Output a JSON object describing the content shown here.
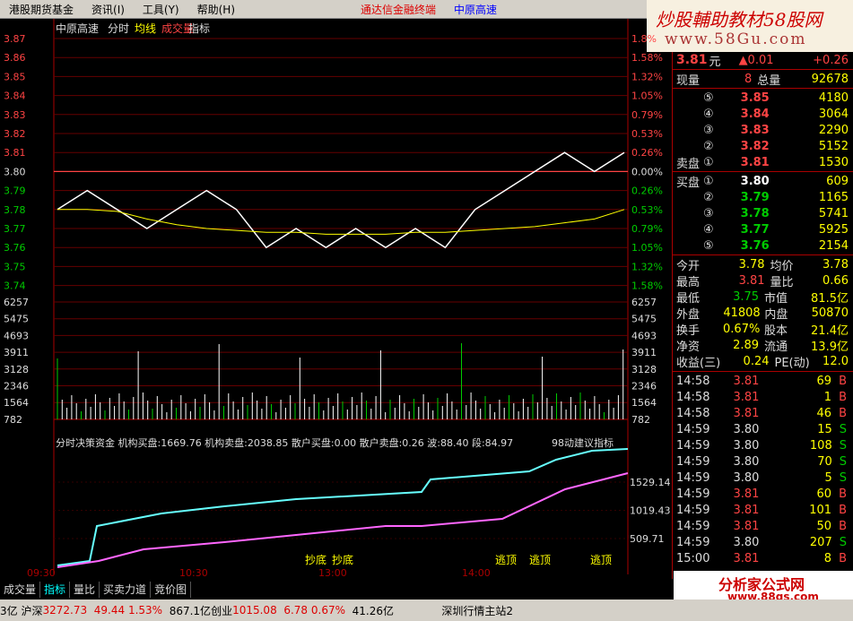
{
  "menu": {
    "items": [
      "港股期货基金",
      "资讯(I)",
      "工具(Y)",
      "帮助(H)"
    ],
    "brand": "通达信金融终端",
    "stock_name": "中原高速"
  },
  "logo": {
    "line1": "炒股輔助教材58股网",
    "line2": "www.58Gu.com"
  },
  "chart": {
    "header": {
      "name": "中原高速",
      "tabs": [
        "分时",
        "均线",
        "成交量",
        "指标"
      ]
    },
    "price_left": [
      "3.87",
      "3.86",
      "3.85",
      "3.84",
      "3.83",
      "3.82",
      "3.81",
      "3.80",
      "3.79",
      "3.78",
      "3.77",
      "3.76",
      "3.75",
      "3.74"
    ],
    "price_right": [
      "1.8%",
      "1.58%",
      "1.32%",
      "1.05%",
      "0.79%",
      "0.53%",
      "0.26%",
      "0.00%",
      "0.26%",
      "0.53%",
      "0.79%",
      "1.05%",
      "1.32%",
      "1.58%"
    ],
    "vol_left": [
      "6257",
      "5475",
      "4693",
      "3911",
      "3128",
      "2346",
      "1564",
      "782"
    ],
    "vol_right": [
      "6257",
      "5475",
      "4693",
      "3911",
      "3128",
      "2346",
      "1564",
      "782"
    ],
    "indicator_title": "分时决策资金 机构买盘:1669.76 机构卖盘:2038.85 散户买盘:0.00 散户卖盘:0.26 波:88.40 段:84.97",
    "indicator_tag": "98动建议指标",
    "ind_right": [
      "1529.14",
      "1019.43",
      "509.71"
    ],
    "time_labels": [
      "09:30",
      "10:30",
      "13:00",
      "14:00"
    ],
    "signals": [
      "抄底",
      "抄底",
      "逃顶",
      "逃顶",
      "逃顶"
    ]
  },
  "chart_data": {
    "type": "line",
    "series": [
      {
        "values": [
          3.78,
          3.79,
          3.78,
          3.77,
          3.78,
          3.79,
          3.78,
          3.76,
          3.77,
          3.76,
          3.77,
          3.76,
          3.77,
          3.76,
          3.78,
          3.79,
          3.8,
          3.81,
          3.8,
          3.81
        ]
      },
      {
        "values": [
          3.78,
          3.78,
          3.779,
          3.775,
          3.772,
          3.77,
          3.769,
          3.768,
          3.768,
          3.767,
          3.767,
          3.767,
          3.768,
          3.768,
          3.769,
          3.77,
          3.771,
          3.773,
          3.775,
          3.78
        ]
      }
    ],
    "ylim": [
      3.74,
      3.87
    ]
  },
  "panel": {
    "price": "3.81",
    "unit": "元",
    "change": "▲0.01",
    "change2": "+0.26",
    "now_vol_label": "现量",
    "now_vol": "8",
    "total_label": "总量",
    "total": "92678",
    "sells": [
      {
        "n": "⑤",
        "p": "3.85",
        "v": "4180"
      },
      {
        "n": "④",
        "p": "3.84",
        "v": "3064"
      },
      {
        "n": "③",
        "p": "3.83",
        "v": "2290"
      },
      {
        "n": "②",
        "p": "3.82",
        "v": "5152"
      },
      {
        "n": "①",
        "p": "3.81",
        "v": "1530",
        "label": "卖盘"
      }
    ],
    "buys": [
      {
        "n": "①",
        "p": "3.80",
        "v": "609",
        "label": "买盘"
      },
      {
        "n": "②",
        "p": "3.79",
        "v": "1165"
      },
      {
        "n": "③",
        "p": "3.78",
        "v": "5741"
      },
      {
        "n": "④",
        "p": "3.77",
        "v": "5925"
      },
      {
        "n": "⑤",
        "p": "3.76",
        "v": "2154"
      }
    ],
    "stats": [
      [
        "今开",
        "3.78",
        "均价",
        "3.78"
      ],
      [
        "最高",
        "3.81",
        "量比",
        "0.66"
      ],
      [
        "最低",
        "3.75",
        "市值",
        "81.5亿"
      ],
      [
        "外盘",
        "41808",
        "内盘",
        "50870"
      ],
      [
        "换手",
        "0.67%",
        "股本",
        "21.4亿"
      ],
      [
        "净资",
        "2.89",
        "流通",
        "13.9亿"
      ],
      [
        "收益(三)",
        "0.24",
        "PE(动)",
        "12.0"
      ]
    ],
    "trades": [
      [
        "14:58",
        "3.81",
        "69",
        "B"
      ],
      [
        "14:58",
        "3.81",
        "1",
        "B"
      ],
      [
        "14:58",
        "3.81",
        "46",
        "B"
      ],
      [
        "14:59",
        "3.80",
        "15",
        "S"
      ],
      [
        "14:59",
        "3.80",
        "108",
        "S"
      ],
      [
        "14:59",
        "3.80",
        "70",
        "S"
      ],
      [
        "14:59",
        "3.80",
        "5",
        "S"
      ],
      [
        "14:59",
        "3.81",
        "60",
        "B"
      ],
      [
        "14:59",
        "3.81",
        "101",
        "B"
      ],
      [
        "14:59",
        "3.81",
        "50",
        "B"
      ],
      [
        "14:59",
        "3.80",
        "207",
        "S"
      ],
      [
        "15:00",
        "3.81",
        "8",
        "B"
      ]
    ]
  },
  "tabs": [
    "成交量",
    "指标",
    "量比",
    "买卖力道",
    "竞价图"
  ],
  "badge": {
    "text": "分析家公式网",
    "url": "www.88gs.com"
  },
  "status": {
    "a": "3亿",
    "sh": "沪深",
    "sh_val": "3272.73",
    "sh_chg": "49.44",
    "sh_pct": "1.53%",
    "sh_amt": "867.1亿",
    "cy": "创业",
    "cy_val": "1015.08",
    "cy_chg": "6.78",
    "cy_pct": "0.67%",
    "cy_amt": "41.26亿",
    "server": "深圳行情主站2"
  }
}
